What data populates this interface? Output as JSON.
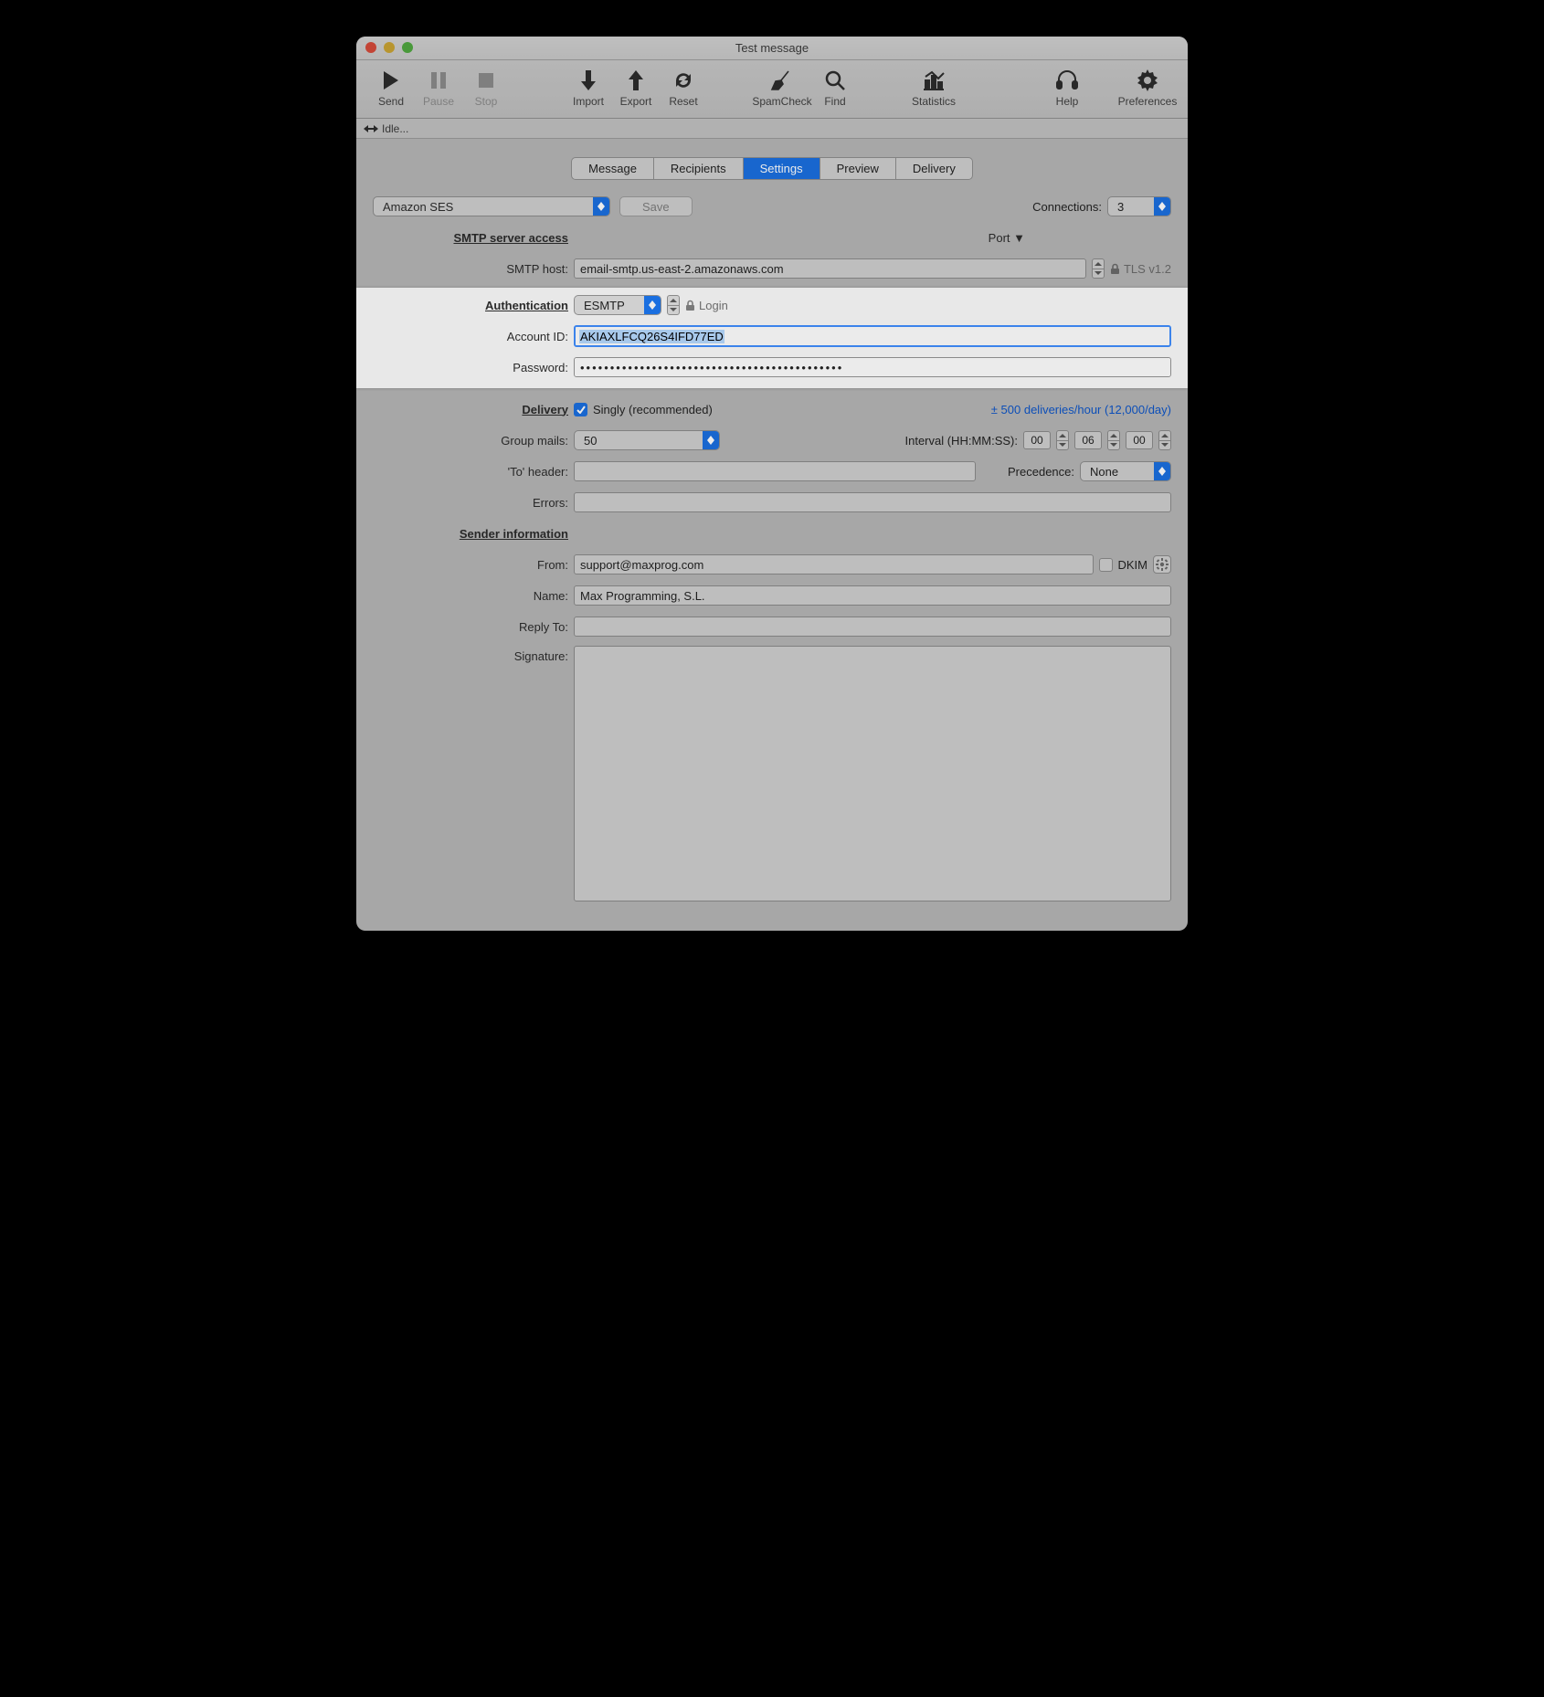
{
  "window": {
    "title": "Test message"
  },
  "toolbar": {
    "send": "Send",
    "pause": "Pause",
    "stop": "Stop",
    "import": "Import",
    "export": "Export",
    "reset": "Reset",
    "spamcheck": "SpamCheck",
    "find": "Find",
    "statistics": "Statistics",
    "help": "Help",
    "preferences": "Preferences"
  },
  "status": {
    "text": "Idle..."
  },
  "tabs": {
    "message": "Message",
    "recipients": "Recipients",
    "settings": "Settings",
    "preview": "Preview",
    "delivery": "Delivery",
    "active": "settings"
  },
  "settings": {
    "preset": "Amazon SES",
    "save": "Save",
    "connections_label": "Connections:",
    "connections": "3",
    "section_smtp": "SMTP server access",
    "port_label": "Port ▼",
    "smtp_host_label": "SMTP host:",
    "smtp_host": "email-smtp.us-east-2.amazonaws.com",
    "tls": "TLS v1.2",
    "section_auth": "Authentication",
    "auth_method": "ESMTP",
    "auth_mode": "Login",
    "account_id_label": "Account ID:",
    "account_id": "AKIAXLFCQ26S4IFD77ED",
    "password_label": "Password:",
    "password_masked": "••••••••••••••••••••••••••••••••••••••••••••",
    "section_delivery": "Delivery",
    "singly": "Singly (recommended)",
    "rate_text": "± 500 deliveries/hour (12,000/day)",
    "group_mails_label": "Group mails:",
    "group_mails": "50",
    "interval_label": "Interval (HH:MM:SS):",
    "interval_hh": "00",
    "interval_mm": "06",
    "interval_ss": "00",
    "to_header_label": "'To' header:",
    "precedence_label": "Precedence:",
    "precedence": "None",
    "errors_label": "Errors:",
    "section_sender": "Sender information",
    "from_label": "From:",
    "from": "support@maxprog.com",
    "dkim": "DKIM",
    "name_label": "Name:",
    "name": "Max Programming, S.L.",
    "reply_to_label": "Reply To:",
    "signature_label": "Signature:"
  }
}
